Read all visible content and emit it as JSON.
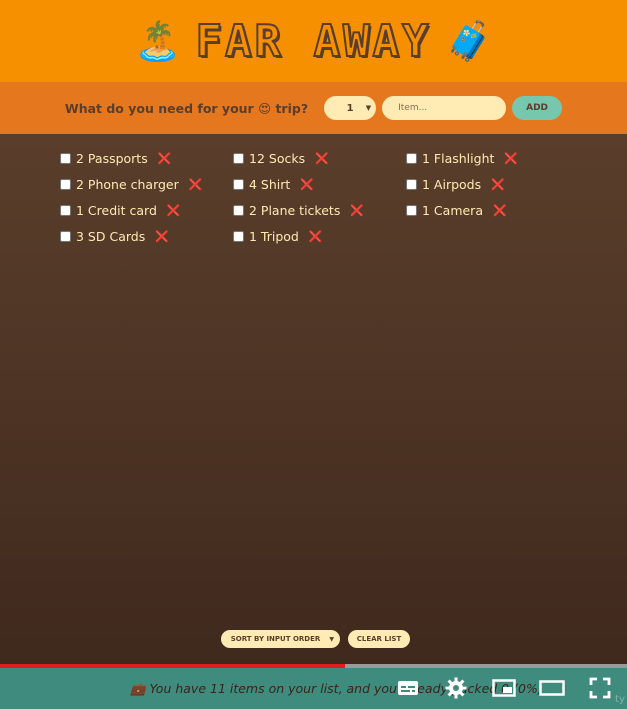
{
  "header": {
    "title": "FAR AWAY",
    "left_emoji": "🏝️",
    "right_emoji": "🧳"
  },
  "form": {
    "prompt": "What do you need for your 😍 trip?",
    "quantity": "1",
    "item_placeholder": "Item...",
    "add_label": "ADD"
  },
  "items": [
    {
      "label": "2 Passports"
    },
    {
      "label": "12 Socks"
    },
    {
      "label": "1 Flashlight"
    },
    {
      "label": "2 Phone charger"
    },
    {
      "label": "4 Shirt"
    },
    {
      "label": "1 Airpods"
    },
    {
      "label": "1 Credit card"
    },
    {
      "label": "2 Plane tickets"
    },
    {
      "label": "1 Camera"
    },
    {
      "label": "3 SD Cards"
    },
    {
      "label": "1 Tripod"
    }
  ],
  "delete_glyph": "❌",
  "actions": {
    "sort_label": "SORT BY INPUT ORDER",
    "clear_label": "CLEAR LIST"
  },
  "stats": {
    "text": "💼 You have 11 items on your list, and you already packed 0 (0%)"
  },
  "video": {
    "progress_fraction": 0.55,
    "watermark": "ty"
  },
  "colors": {
    "header": "#f69000",
    "form": "#e5771f",
    "list_bg": "#5a3e2b",
    "stats_bg": "#3f8b7d",
    "text": "#ffebb3",
    "accent": "#76c7ad"
  }
}
